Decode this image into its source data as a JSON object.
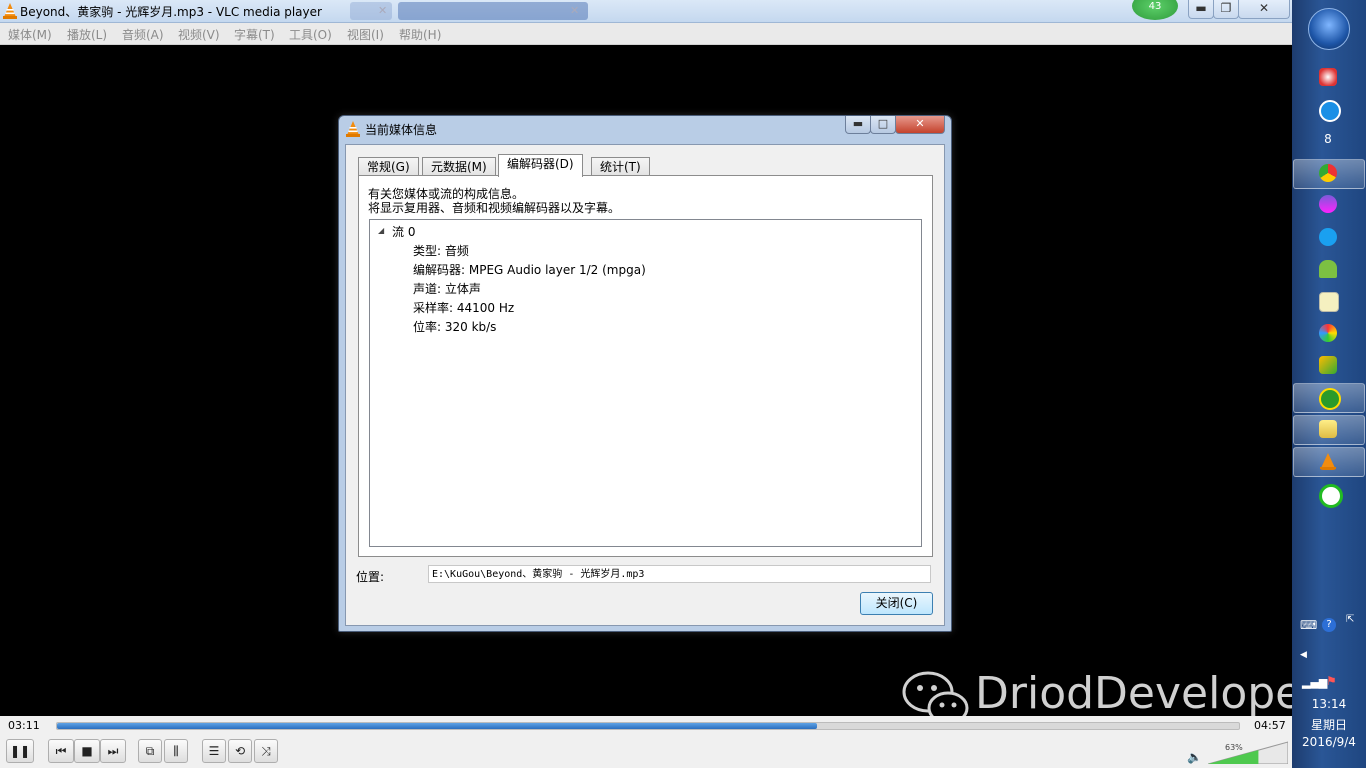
{
  "window": {
    "title": "Beyond、黄家驹 - 光辉岁月.mp3 - VLC media player",
    "badge_count": "43"
  },
  "menu": [
    "媒体(M)",
    "播放(L)",
    "音频(A)",
    "视频(V)",
    "字幕(T)",
    "工具(O)",
    "视图(I)",
    "帮助(H)"
  ],
  "dialog": {
    "title": "当前媒体信息",
    "tabs": [
      "常规(G)",
      "元数据(M)",
      "编解码器(D)",
      "统计(T)"
    ],
    "active_tab": "编解码器(D)",
    "description_line1": "有关您媒体或流的构成信息。",
    "description_line2": "将显示复用器、音频和视频编解码器以及字幕。",
    "stream": {
      "label": "流 0",
      "type": "类型: 音频",
      "codec": "编解码器: MPEG Audio layer 1/2 (mpga)",
      "channels": "声道: 立体声",
      "sample_rate": "采样率: 44100 Hz",
      "bitrate": "位率: 320 kb/s"
    },
    "location_label": "位置:",
    "location_value": "E:\\KuGou\\Beyond、黄家驹 - 光辉岁月.mp3",
    "close_button": "关闭(C)"
  },
  "watermark": "DriodDeveloper",
  "player": {
    "elapsed": "03:11",
    "total": "04:57",
    "progress": 0.643,
    "volume_percent": "63%"
  },
  "taskbar": {
    "time": "13:14",
    "weekday": "星期日",
    "date": "2016/9/4"
  },
  "colors": {
    "seek_fill": "#2b6fbf",
    "taskbar": "#2a5696",
    "dialog_frame": "#b9cde6"
  }
}
